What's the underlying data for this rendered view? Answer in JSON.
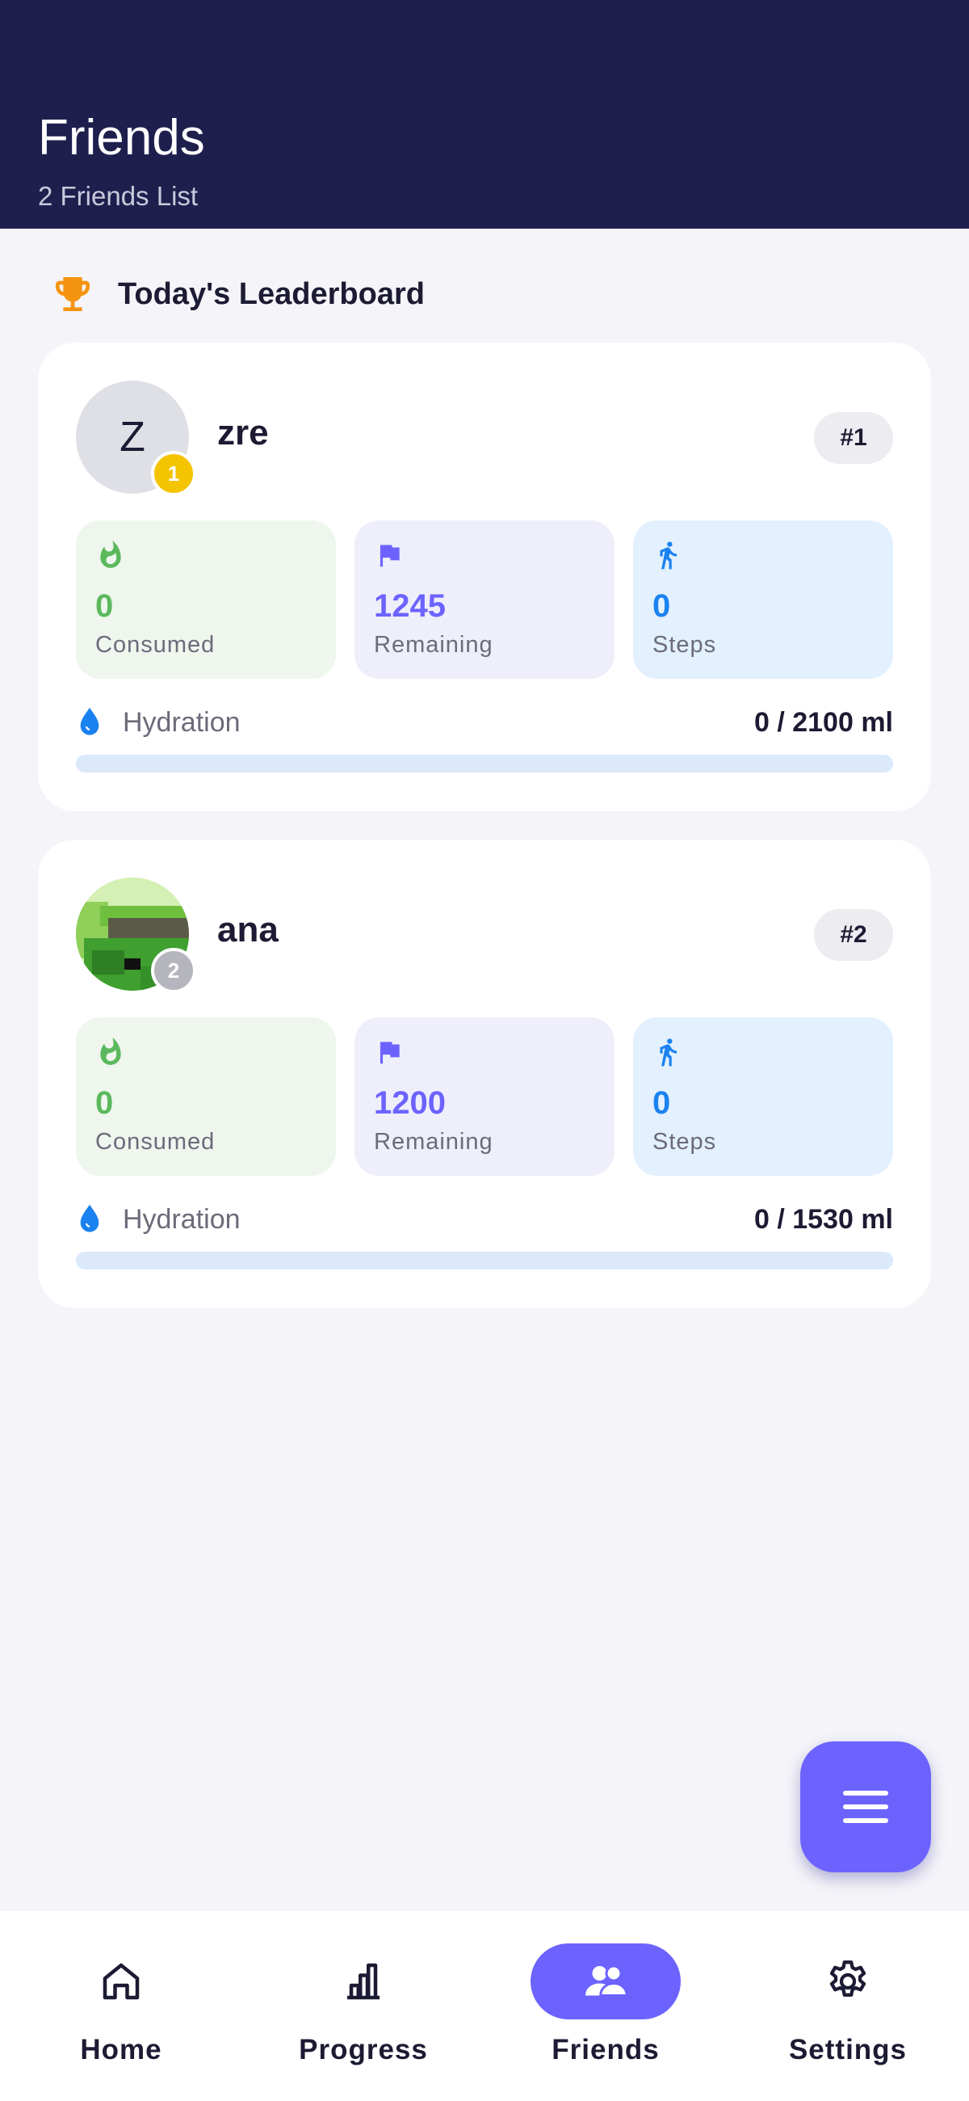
{
  "header": {
    "title": "Friends",
    "subtitle": "2 Friends List"
  },
  "leaderboard": {
    "title": "Today's Leaderboard",
    "icon": "trophy-icon",
    "accent": "#f5940f"
  },
  "friends": [
    {
      "name": "zre",
      "initial": "Z",
      "position": "1",
      "rank": "#1",
      "badge_color": "#f5c400",
      "stats": {
        "consumed": {
          "value": "0",
          "label": "Consumed"
        },
        "remaining": {
          "value": "1245",
          "label": "Remaining"
        },
        "steps": {
          "value": "0",
          "label": "Steps"
        }
      },
      "hydration": {
        "label": "Hydration",
        "value": "0 / 2100 ml",
        "progress": 0
      }
    },
    {
      "name": "ana",
      "initial": "",
      "position": "2",
      "rank": "#2",
      "badge_color": "#b5b5bd",
      "stats": {
        "consumed": {
          "value": "0",
          "label": "Consumed"
        },
        "remaining": {
          "value": "1200",
          "label": "Remaining"
        },
        "steps": {
          "value": "0",
          "label": "Steps"
        }
      },
      "hydration": {
        "label": "Hydration",
        "value": "0 / 1530 ml",
        "progress": 0
      }
    }
  ],
  "fab": {
    "icon": "menu-icon"
  },
  "nav": {
    "items": [
      {
        "label": "Home",
        "icon": "home-icon",
        "active": false
      },
      {
        "label": "Progress",
        "icon": "bar-chart-icon",
        "active": false
      },
      {
        "label": "Friends",
        "icon": "people-icon",
        "active": true
      },
      {
        "label": "Settings",
        "icon": "gear-icon",
        "active": false
      }
    ]
  },
  "colors": {
    "header_bg": "#1f1f4e",
    "primary": "#6c63ff",
    "consumed": "#5cb85c",
    "steps": "#1a82f0"
  }
}
